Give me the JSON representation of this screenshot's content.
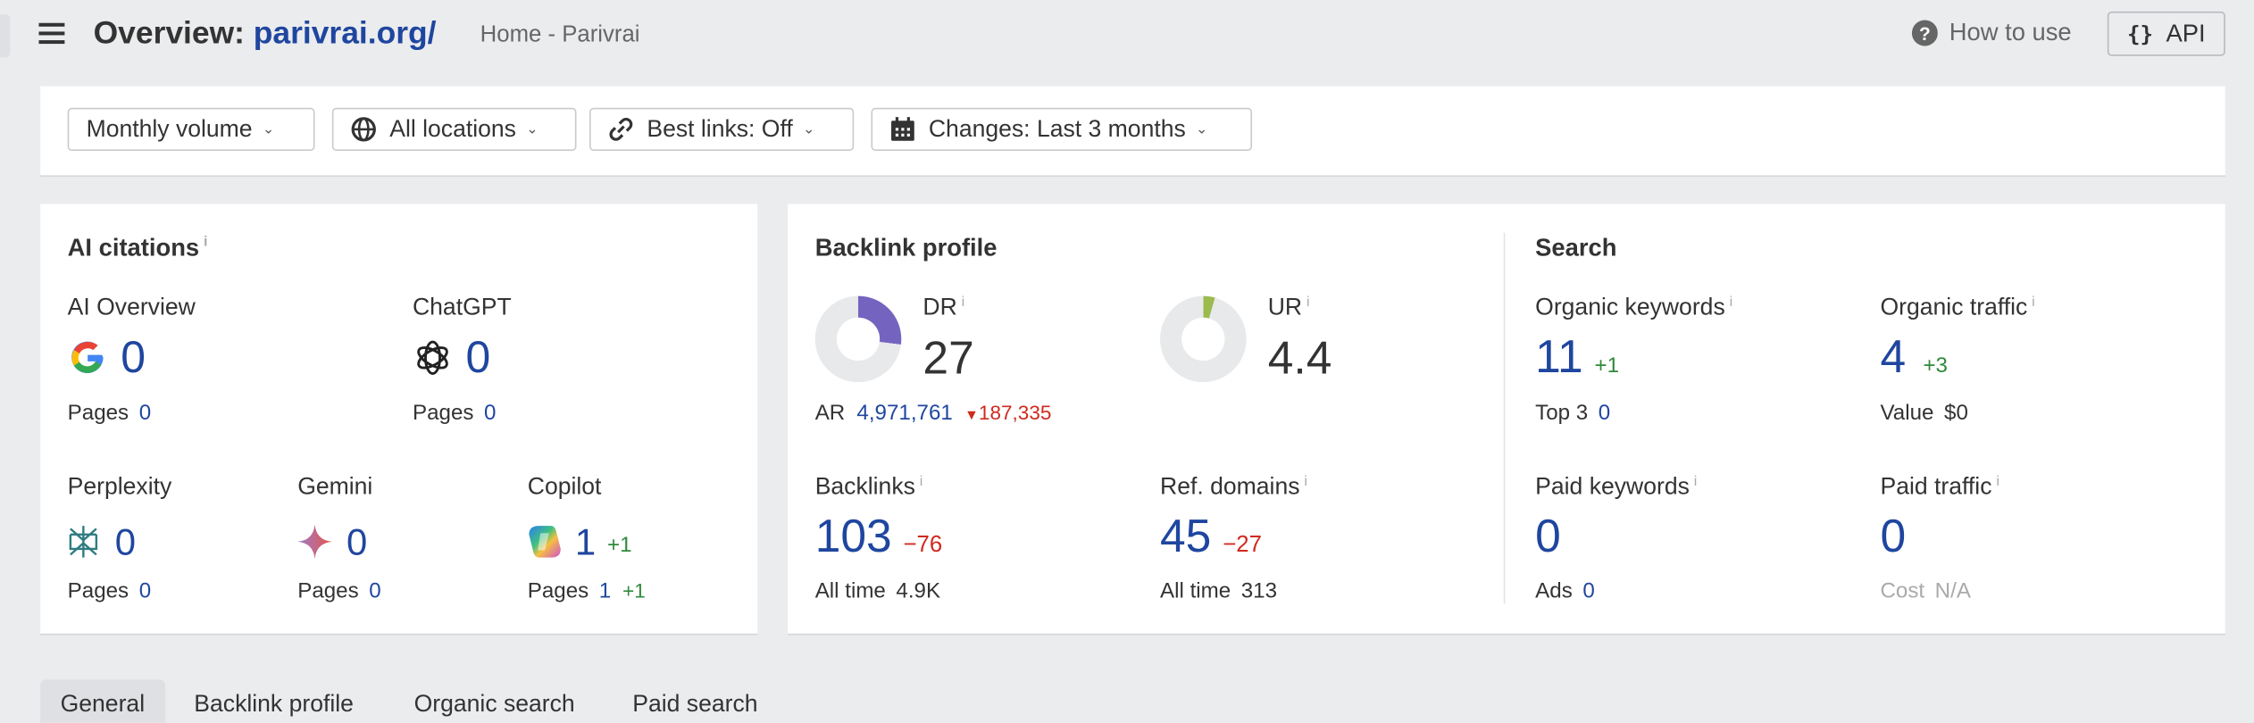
{
  "header": {
    "title_prefix": "Overview:",
    "domain": "parivrai.org/",
    "page_title": "Home - Parivrai",
    "how_to_use": "How to use",
    "api": "API",
    "api_icon": "{}"
  },
  "filters": [
    {
      "label": "Monthly volume"
    },
    {
      "label": "All locations",
      "icon": "globe-icon"
    },
    {
      "label": "Best links: Off",
      "icon": "link-icon"
    },
    {
      "label": "Changes: Last 3 months",
      "icon": "calendar-icon"
    }
  ],
  "ai_citations": {
    "title": "AI citations",
    "ai_overview": {
      "label": "AI Overview",
      "value": "0",
      "pages_label": "Pages",
      "pages": "0"
    },
    "chatgpt": {
      "label": "ChatGPT",
      "value": "0",
      "pages_label": "Pages",
      "pages": "0"
    },
    "perplexity": {
      "label": "Perplexity",
      "value": "0",
      "pages_label": "Pages",
      "pages": "0"
    },
    "gemini": {
      "label": "Gemini",
      "value": "0",
      "pages_label": "Pages",
      "pages": "0"
    },
    "copilot": {
      "label": "Copilot",
      "value": "1",
      "delta": "+1",
      "pages_label": "Pages",
      "pages": "1",
      "pages_delta": "+1"
    }
  },
  "backlink_profile": {
    "title": "Backlink profile",
    "dr": {
      "label": "DR",
      "value": "27",
      "fill_percent": 27,
      "color": "#7563c0"
    },
    "ur": {
      "label": "UR",
      "value": "4.4",
      "fill_percent": 4.4,
      "color": "#9bbb4f"
    },
    "ar": {
      "label": "AR",
      "value": "4,971,761",
      "delta": "187,335"
    },
    "backlinks": {
      "label": "Backlinks",
      "value": "103",
      "delta": "−76",
      "sub_label": "All time",
      "sub_value": "4.9K"
    },
    "ref_domains": {
      "label": "Ref. domains",
      "value": "45",
      "delta": "−27",
      "sub_label": "All time",
      "sub_value": "313"
    }
  },
  "search": {
    "title": "Search",
    "organic_keywords": {
      "label": "Organic keywords",
      "value": "11",
      "delta": "+1",
      "sub_label": "Top 3",
      "sub_value": "0"
    },
    "organic_traffic": {
      "label": "Organic traffic",
      "value": "4",
      "delta": "+3",
      "sub_label": "Value",
      "sub_value": "$0"
    },
    "paid_keywords": {
      "label": "Paid keywords",
      "value": "0",
      "sub_label": "Ads",
      "sub_value": "0"
    },
    "paid_traffic": {
      "label": "Paid traffic",
      "value": "0",
      "sub_label": "Cost",
      "sub_value": "N/A"
    }
  },
  "tabs": [
    {
      "label": "General",
      "active": true
    },
    {
      "label": "Backlink profile"
    },
    {
      "label": "Organic search"
    },
    {
      "label": "Paid search"
    }
  ],
  "info_glyph": "i"
}
